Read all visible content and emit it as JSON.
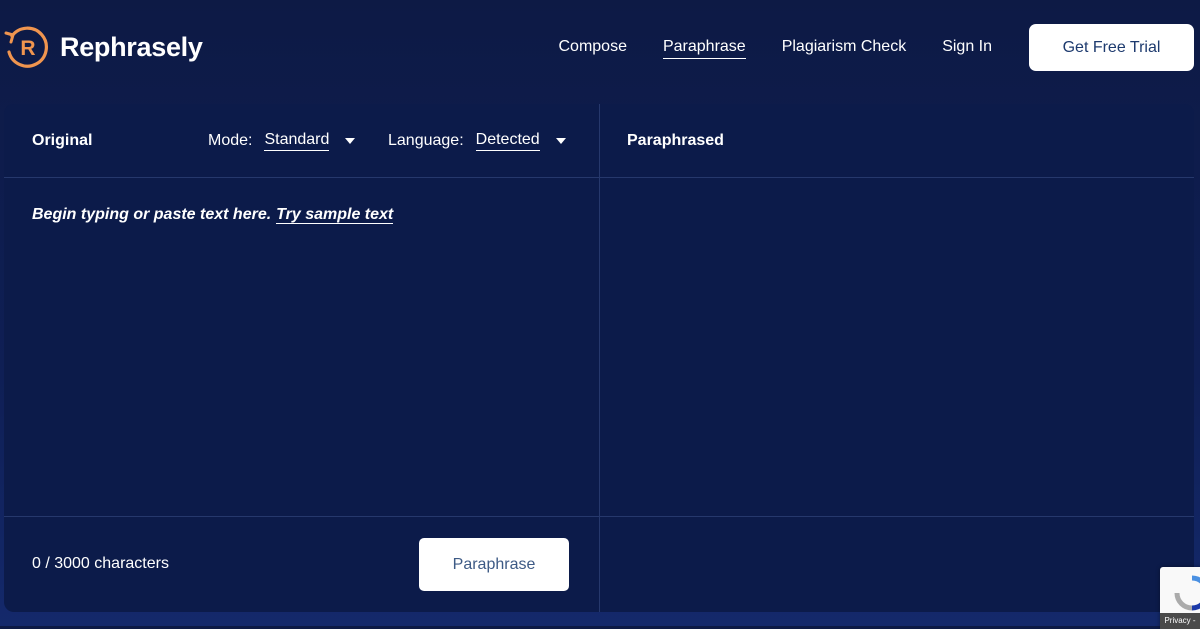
{
  "brand": {
    "name": "Rephrasely",
    "logo_letter": "R",
    "accent_color": "#f0954f"
  },
  "nav": {
    "items": [
      {
        "label": "Compose",
        "active": false
      },
      {
        "label": "Paraphrase",
        "active": true
      },
      {
        "label": "Plagiarism Check",
        "active": false
      },
      {
        "label": "Sign In",
        "active": false
      }
    ],
    "cta_label": "Get Free Trial"
  },
  "editor": {
    "original_title": "Original",
    "mode": {
      "label": "Mode:",
      "value": "Standard"
    },
    "language": {
      "label": "Language:",
      "value": "Detected"
    },
    "paraphrased_title": "Paraphrased",
    "placeholder": "Begin typing or paste text here.",
    "sample_link": "Try sample text",
    "char_count": "0 / 3000 characters",
    "paraphrase_button": "Paraphrase"
  },
  "recaptcha": {
    "privacy_label": "Privacy -"
  },
  "colors": {
    "background": "#0d1a45",
    "panel": "#0c1b4a",
    "divider": "#26386c",
    "button_text": "#3d5a85"
  }
}
